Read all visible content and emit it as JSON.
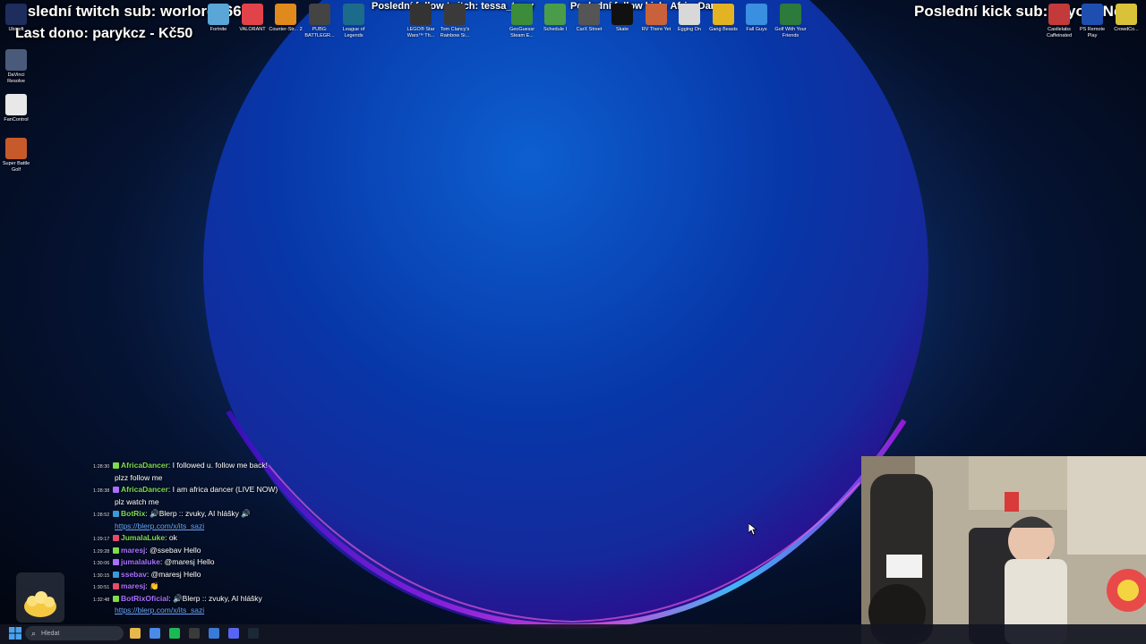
{
  "stream_overlay": {
    "last_twitch_sub": "Poslední twitch sub: worlord266",
    "last_dono": "Last dono: parykcz - Kč50",
    "last_twitch_follow": "Poslední follow twitch: tessa_terry",
    "last_kick_follow": "Poslední follow kick: AfricaDancer",
    "last_kick_sub": "Poslední kick sub: KiyomiNex"
  },
  "desktop_icons": {
    "top_row": [
      {
        "label": "Fortnite",
        "icon": "fortnite-icon",
        "color": "#5aa6d6"
      },
      {
        "label": "VALORANT",
        "icon": "valorant-icon",
        "color": "#e2434b"
      },
      {
        "label": "Counter-Str... 2",
        "icon": "counter-strike-icon",
        "color": "#e08a1e"
      },
      {
        "label": "PUBG: BATTLEGR...",
        "icon": "pubg-icon",
        "color": "#444444"
      },
      {
        "label": "League of Legends",
        "icon": "league-of-legends-icon",
        "color": "#1d6b8a"
      },
      {
        "label": "LEGO® Star Wars™ Th...",
        "icon": "lego-star-wars-icon",
        "color": "#333333"
      },
      {
        "label": "Tom Clancy's Rainbow Si...",
        "icon": "rainbow-six-icon",
        "color": "#3a3a3a"
      },
      {
        "label": "GeoGuessr Steam E...",
        "icon": "geoguessr-icon",
        "color": "#3d8c3a"
      },
      {
        "label": "Schedule I",
        "icon": "schedule-one-icon",
        "color": "#4a9c4a"
      },
      {
        "label": "CarX Street",
        "icon": "carx-street-icon",
        "color": "#555555"
      },
      {
        "label": "Skate",
        "icon": "skate-icon",
        "color": "#111111"
      },
      {
        "label": "RV There Yet",
        "icon": "rv-there-yet-icon",
        "color": "#c9623a"
      },
      {
        "label": "Egging On",
        "icon": "egging-on-icon",
        "color": "#d8d8d8"
      },
      {
        "label": "Gang Beasts",
        "icon": "gang-beasts-icon",
        "color": "#e4b321"
      },
      {
        "label": "Fall Guys",
        "icon": "fall-guys-icon",
        "color": "#3a8fe0"
      },
      {
        "label": "Golf With Your Friends",
        "icon": "golf-with-friends-icon",
        "color": "#2c7a3c"
      },
      {
        "label": "Castlelabs Caffeinated",
        "icon": "caffeinated-icon",
        "color": "#c23a3a"
      },
      {
        "label": "PS Remote Play",
        "icon": "ps-remote-play-icon",
        "color": "#1e4fb0"
      },
      {
        "label": "CrowdCo...",
        "icon": "crowdcontrol-icon",
        "color": "#d9c23a"
      }
    ],
    "left_column": [
      {
        "label": "Ubisoft",
        "icon": "ubisoft-icon",
        "color": "#1e2d5c"
      },
      {
        "label": "DaVinci Resolve",
        "icon": "davinci-resolve-icon",
        "color": "#4a5a7a"
      },
      {
        "label": "FanControl",
        "icon": "fancontrol-icon",
        "color": "#e8e8e8"
      },
      {
        "label": "Super Battle Golf",
        "icon": "super-battle-golf-icon",
        "color": "#c65a2a"
      }
    ]
  },
  "chat": {
    "messages": [
      {
        "time": "1:28:30",
        "user": "AfricaDancer",
        "user_color": "#7ddc4a",
        "text": ": I followed u. follow me back!",
        "cont": "plzz follow me"
      },
      {
        "time": "1:28:38",
        "user": "AfricaDancer",
        "user_color": "#7ddc4a",
        "text": ": I am africa dancer (LIVE NOW)",
        "cont": "plz watch me"
      },
      {
        "time": "1:28:52",
        "user": "BotRix",
        "user_color": "#7ddc4a",
        "text": ": 🔊Blerp :: zvuky, AI hlášky 🔊",
        "link": "https://blerp.com/x/its_sazi"
      },
      {
        "time": "1:29:17",
        "user": "JumalaLuke",
        "user_color": "#7ddc4a",
        "text": ": ok"
      },
      {
        "time": "1:29:28",
        "user": "maresj",
        "user_color": "#a970ff",
        "text": ": @ssebav Hello"
      },
      {
        "time": "1:30:06",
        "user": "jumalaluke",
        "user_color": "#a970ff",
        "text": ": @maresj Hello"
      },
      {
        "time": "1:30:15",
        "user": "ssebav",
        "user_color": "#a970ff",
        "text": ": @maresj Hello"
      },
      {
        "time": "1:30:51",
        "user": "maresj",
        "user_color": "#a970ff",
        "text": ": 👏"
      },
      {
        "time": "1:32:48",
        "user": "BotRixOficial",
        "user_color": "#a970ff",
        "text": ": 🔊Blerp :: zvuky, AI hlášky",
        "link": "https://blerp.com/x/its_sazi"
      }
    ]
  },
  "taskbar": {
    "search_placeholder": "Hledat",
    "apps": [
      {
        "icon": "file-explorer-icon",
        "color": "#e8b84a"
      },
      {
        "icon": "chrome-icon",
        "color": "#4a8ae8"
      },
      {
        "icon": "spotify-icon",
        "color": "#1db954"
      },
      {
        "icon": "obs-icon",
        "color": "#3a3a3a"
      },
      {
        "icon": "browser-icon",
        "color": "#3a7ad8"
      },
      {
        "icon": "discord-icon",
        "color": "#5865f2"
      },
      {
        "icon": "steam-icon",
        "color": "#1b2838"
      }
    ]
  }
}
